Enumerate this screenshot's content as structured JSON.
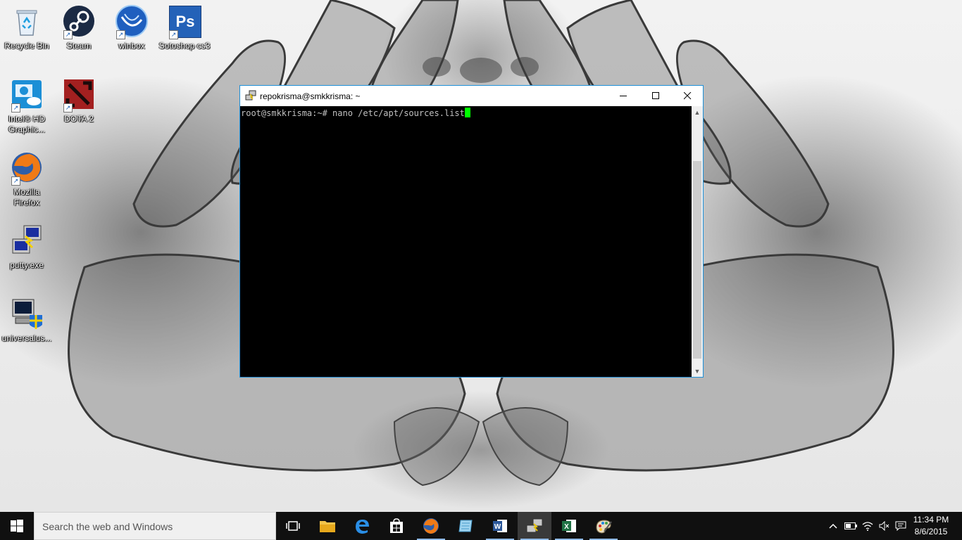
{
  "desktop": {
    "icons": [
      {
        "label": "Recycle Bin"
      },
      {
        "label": "Steam"
      },
      {
        "label": "winbox"
      },
      {
        "label": "Sotoshop cs3",
        "glyph": "Ps"
      },
      {
        "label": "Intel® HD Graphic..."
      },
      {
        "label": "DOTA 2"
      },
      {
        "label": "Mozilla Firefox"
      },
      {
        "label": "putty.exe"
      },
      {
        "label": "universalus..."
      }
    ]
  },
  "window": {
    "title": "repokrisma@smkkrisma: ~",
    "terminal_line": "root@smkkrisma:~# nano /etc/apt/sources.list",
    "border_color": "#1e90d8",
    "cursor_color": "#00ff00"
  },
  "taskbar": {
    "search_placeholder": "Search the web and Windows",
    "apps": [
      "task-view",
      "file-explorer",
      "edge",
      "store",
      "firefox",
      "notepad",
      "word",
      "putty",
      "excel",
      "paint"
    ],
    "active_app": "putty",
    "clock": {
      "time": "11:34 PM",
      "date": "8/6/2015"
    }
  }
}
